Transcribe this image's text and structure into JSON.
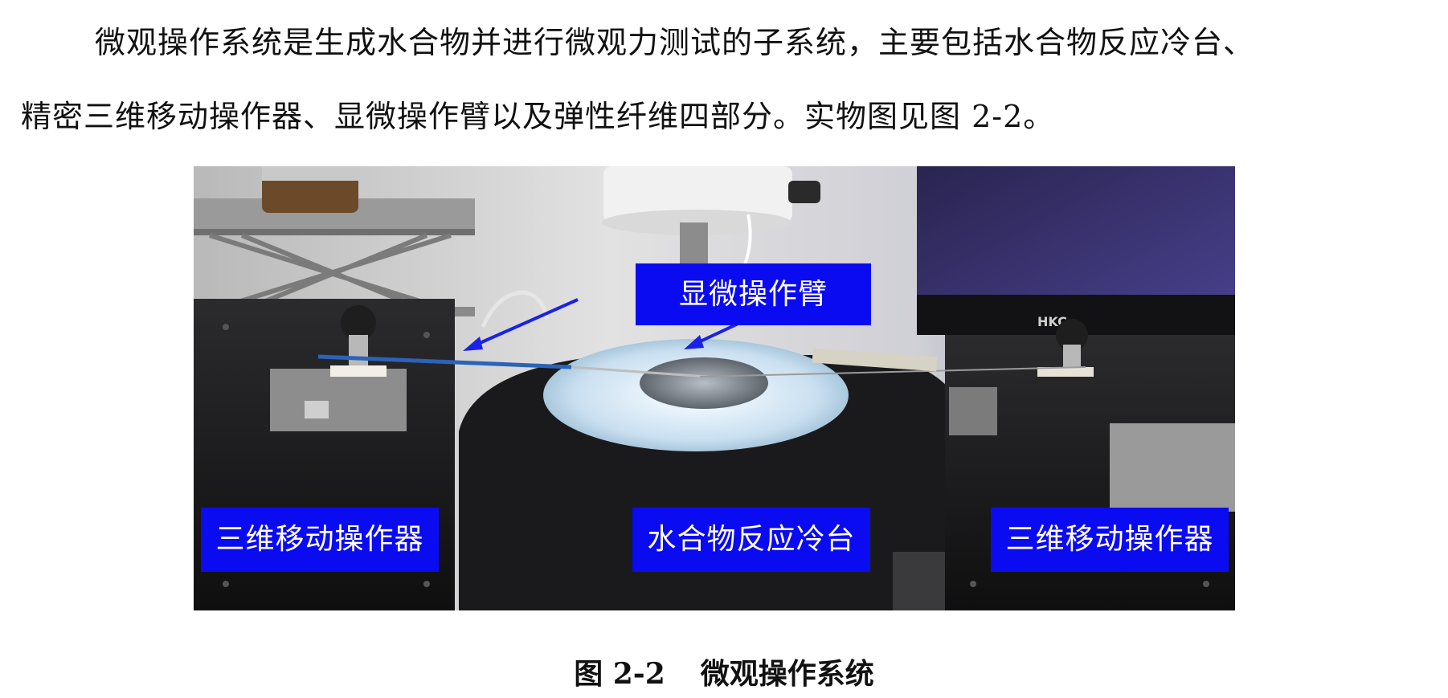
{
  "paragraph": {
    "line1": "微观操作系统是生成水合物并进行微观力测试的子系统，主要包括水合物反应冷台、",
    "line2": "精密三维移动操作器、显微操作臂以及弹性纤维四部分。实物图见图 2-2。"
  },
  "figure": {
    "labels": {
      "arm": "显微操作臂",
      "left_manipulator": "三维移动操作器",
      "cold_stage": "水合物反应冷台",
      "right_manipulator": "三维移动操作器"
    },
    "monitor_brand": "HKC",
    "label_color": "#0b0bf2",
    "arrow_color": "#1a22e6"
  },
  "caption": {
    "number": "图 2-2",
    "title": "微观操作系统"
  }
}
